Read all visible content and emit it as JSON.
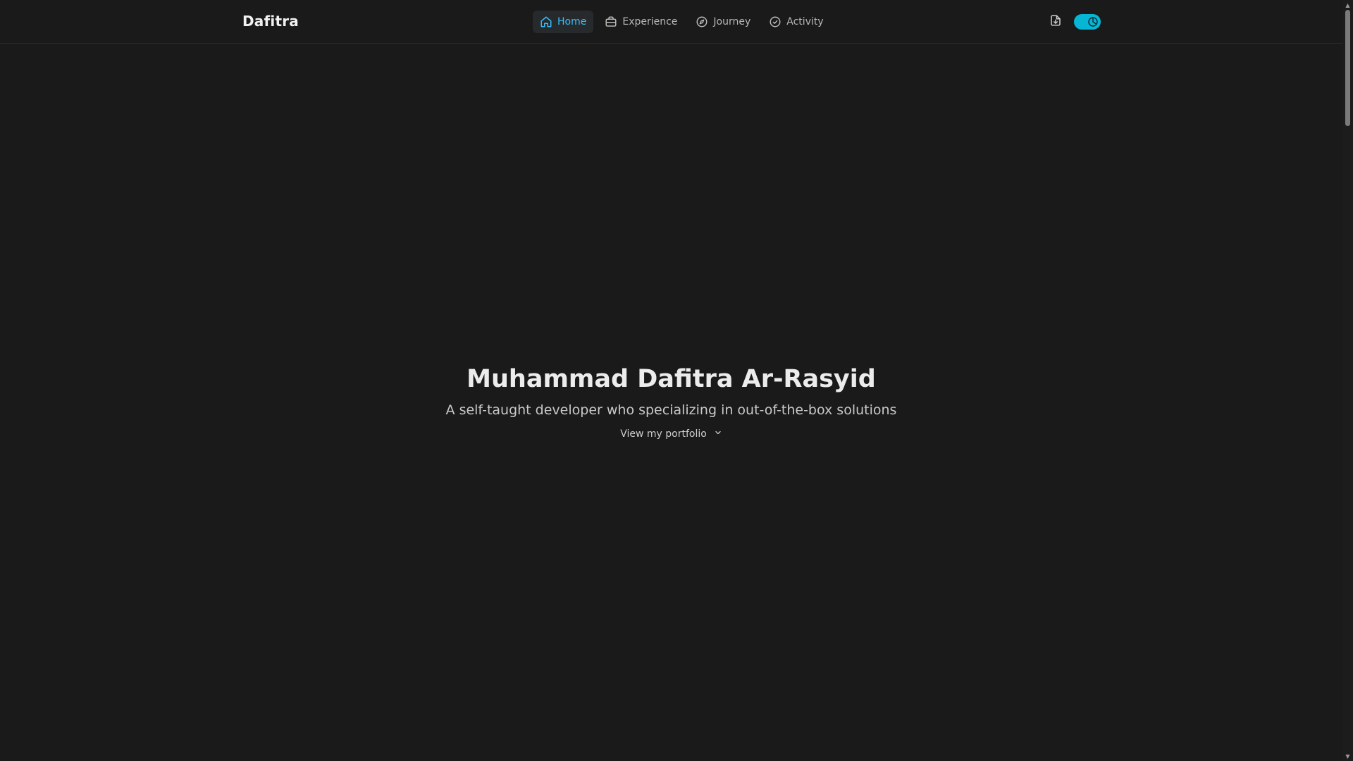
{
  "header": {
    "brand": "Dafitra",
    "nav": [
      {
        "label": "Home",
        "icon": "home-icon",
        "active": true
      },
      {
        "label": "Experience",
        "icon": "briefcase-icon",
        "active": false
      },
      {
        "label": "Journey",
        "icon": "compass-icon",
        "active": false
      },
      {
        "label": "Activity",
        "icon": "check-circle-icon",
        "active": false
      }
    ],
    "actions": {
      "download_icon": "file-download-icon",
      "theme_toggle_icon": "moon-icon",
      "theme": "dark"
    }
  },
  "hero": {
    "title": "Muhammad Dafitra Ar-Rasyid",
    "subtitle": "A self-taught developer who specializing in out-of-the-box solutions",
    "cta_label": "View my portfolio",
    "cta_icon": "chevron-down-icon"
  },
  "colors": {
    "background": "#1a1a1a",
    "accent": "#38bdf8",
    "toggle": "#06b6d4"
  }
}
